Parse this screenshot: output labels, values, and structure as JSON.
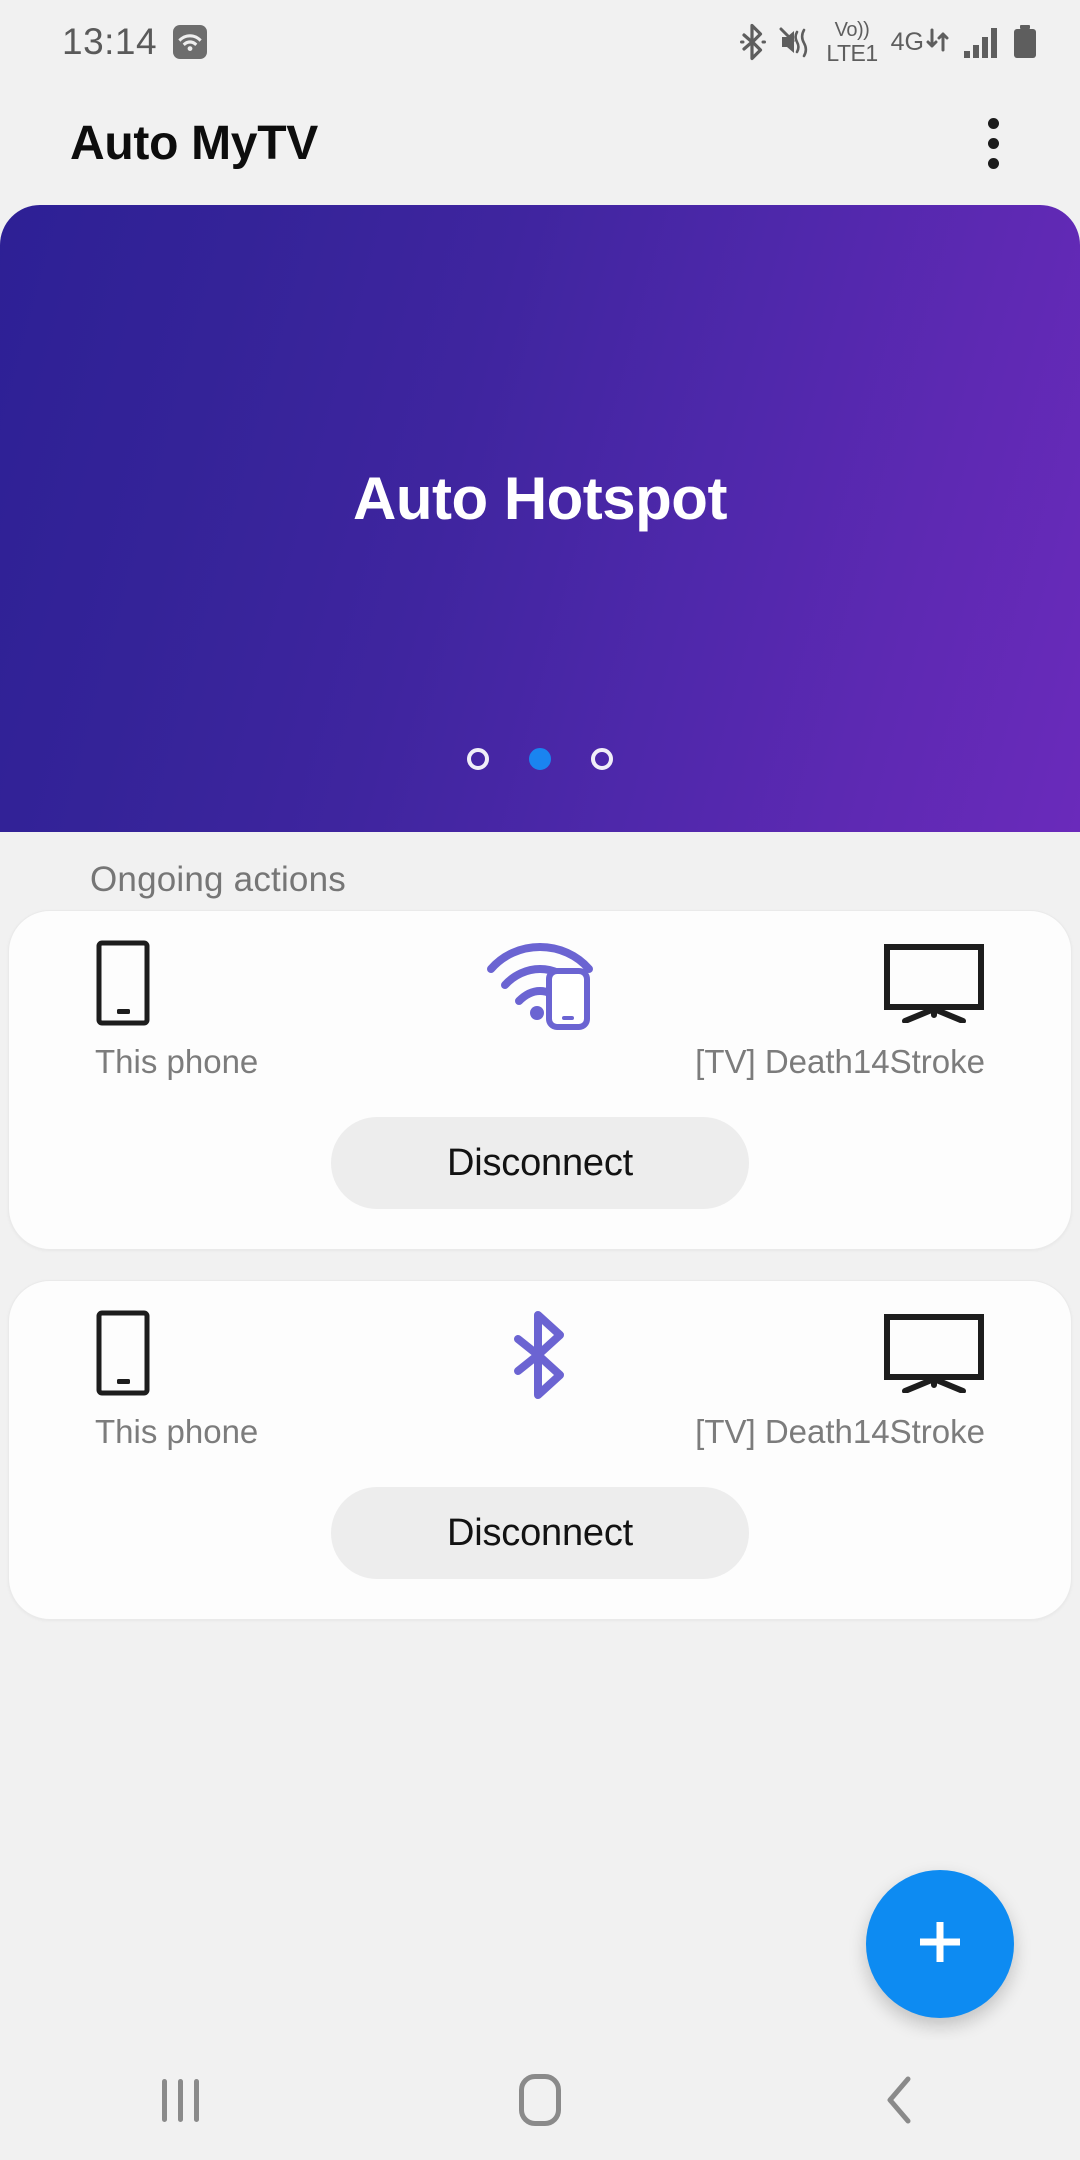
{
  "status_bar": {
    "clock": "13:14",
    "wifi_icon": "wifi-icon",
    "bluetooth_icon": "bluetooth-icon",
    "mute_icon": "mute-vibrate-icon",
    "volte_line1": "Vo))",
    "volte_line2": "LTE1",
    "network_type": "4G",
    "data_arrows_icon": "data-transfer-arrows-icon",
    "signal_icon": "signal-bars-icon",
    "battery_icon": "battery-icon"
  },
  "app_bar": {
    "title": "Auto MyTV",
    "overflow_icon": "overflow-menu-icon"
  },
  "banner": {
    "title": "Auto Hotspot",
    "gradient_start": "#2d2095",
    "gradient_end": "#6a2abb",
    "active_dot_color": "#1a84f0",
    "page_count": 3,
    "active_page_index": 1
  },
  "section": {
    "ongoing_actions_label": "Ongoing actions"
  },
  "cards": [
    {
      "source_label": "This phone",
      "source_icon": "phone-icon",
      "link_icon": "hotspot-wifi-phone-icon",
      "link_icon_color": "#6b64d2",
      "target_label": "[TV] Death14Stroke",
      "target_icon": "tv-icon",
      "button_label": "Disconnect"
    },
    {
      "source_label": "This phone",
      "source_icon": "phone-icon",
      "link_icon": "bluetooth-icon",
      "link_icon_color": "#6b64d2",
      "target_label": "[TV] Death14Stroke",
      "target_icon": "tv-icon",
      "button_label": "Disconnect"
    }
  ],
  "fab": {
    "icon": "plus-icon",
    "color": "#0d8bf2"
  },
  "nav_bar": {
    "recents_icon": "recents-icon",
    "home_icon": "home-icon",
    "back_icon": "back-icon"
  }
}
